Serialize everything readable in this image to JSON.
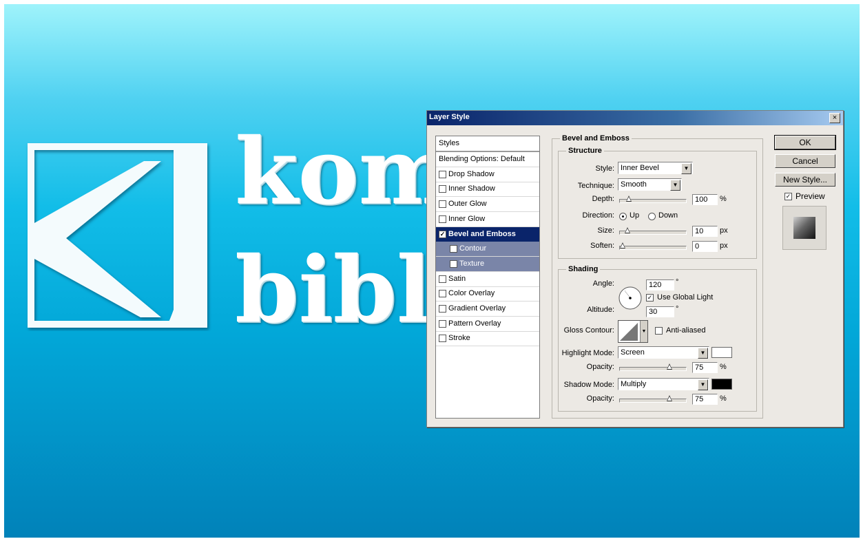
{
  "background": {
    "colors": {
      "top": "#9ff3fb",
      "bottom": "#0182b9",
      "logo": "#ffffff"
    },
    "text_line1": "kom",
    "text_line2": "bibli"
  },
  "dialog": {
    "title": "Layer Style",
    "close_label": "×",
    "left_list": {
      "header": "Styles",
      "items": [
        {
          "label": "Blending Options: Default",
          "checkbox": false,
          "checked": false,
          "state": "normal"
        },
        {
          "label": "Drop Shadow",
          "checkbox": true,
          "checked": false,
          "state": "normal"
        },
        {
          "label": "Inner Shadow",
          "checkbox": true,
          "checked": false,
          "state": "normal"
        },
        {
          "label": "Outer Glow",
          "checkbox": true,
          "checked": false,
          "state": "normal"
        },
        {
          "label": "Inner Glow",
          "checkbox": true,
          "checked": false,
          "state": "normal"
        },
        {
          "label": "Bevel and Emboss",
          "checkbox": true,
          "checked": true,
          "state": "selected"
        },
        {
          "label": "Contour",
          "checkbox": true,
          "checked": false,
          "state": "sub"
        },
        {
          "label": "Texture",
          "checkbox": true,
          "checked": false,
          "state": "sub"
        },
        {
          "label": "Satin",
          "checkbox": true,
          "checked": false,
          "state": "normal"
        },
        {
          "label": "Color Overlay",
          "checkbox": true,
          "checked": false,
          "state": "normal"
        },
        {
          "label": "Gradient Overlay",
          "checkbox": true,
          "checked": false,
          "state": "normal"
        },
        {
          "label": "Pattern Overlay",
          "checkbox": true,
          "checked": false,
          "state": "normal"
        },
        {
          "label": "Stroke",
          "checkbox": true,
          "checked": false,
          "state": "normal"
        }
      ]
    },
    "panel_title": "Bevel and Emboss",
    "structure": {
      "title": "Structure",
      "style_label": "Style:",
      "style_value": "Inner Bevel",
      "technique_label": "Technique:",
      "technique_value": "Smooth",
      "depth_label": "Depth:",
      "depth_value": "100",
      "depth_unit": "%",
      "depth_slider": 0.1,
      "direction_label": "Direction:",
      "direction_up": "Up",
      "direction_down": "Down",
      "size_label": "Size:",
      "size_value": "10",
      "size_unit": "px",
      "size_slider": 0.08,
      "soften_label": "Soften:",
      "soften_value": "0",
      "soften_unit": "px",
      "soften_slider": 0.0
    },
    "shading": {
      "title": "Shading",
      "angle_label": "Angle:",
      "angle_value": "120",
      "angle_unit": "°",
      "global_light_label": "Use Global Light",
      "altitude_label": "Altitude:",
      "altitude_value": "30",
      "altitude_unit": "°",
      "gloss_contour_label": "Gloss Contour:",
      "anti_aliased_label": "Anti-aliased",
      "highlight_mode_label": "Highlight Mode:",
      "highlight_mode_value": "Screen",
      "highlight_color": "#ffffff",
      "highlight_opacity_label": "Opacity:",
      "highlight_opacity_value": "75",
      "highlight_opacity_unit": "%",
      "highlight_opacity_slider": 0.75,
      "shadow_mode_label": "Shadow Mode:",
      "shadow_mode_value": "Multiply",
      "shadow_color": "#000000",
      "shadow_opacity_label": "Opacity:",
      "shadow_opacity_value": "75",
      "shadow_opacity_unit": "%",
      "shadow_opacity_slider": 0.75
    },
    "buttons": {
      "ok": "OK",
      "cancel": "Cancel",
      "new_style": "New Style...",
      "preview_label": "Preview"
    }
  }
}
